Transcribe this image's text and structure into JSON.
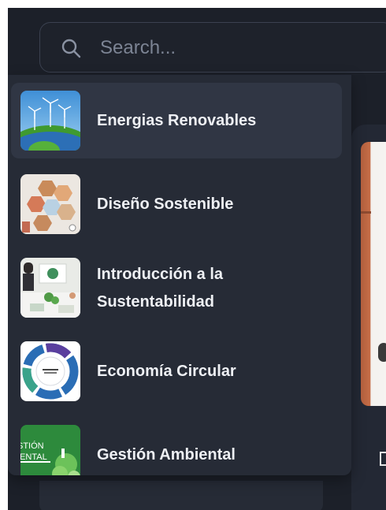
{
  "search": {
    "placeholder": "Search..."
  },
  "dropdown": {
    "items": [
      {
        "label": "Energias Renovables",
        "thumb": "wind-turbines-earth",
        "active": true
      },
      {
        "label": "Diseño Sostenible",
        "thumb": "hexagon-tiles"
      },
      {
        "label_line1": "Introducción a la",
        "label_line2": "Sustentabilidad",
        "thumb": "classroom-presentation"
      },
      {
        "label": "Economía Circular",
        "thumb": "circular-economy-diagram"
      },
      {
        "label": "Gestión Ambiental",
        "thumb_text": "STIÓN IENTAL",
        "thumb_line1": "STIÓN",
        "thumb_line2": "IENTAL"
      }
    ]
  },
  "colors": {
    "background": "#1c2029",
    "dropdown": "#262b36",
    "active_item": "#303644",
    "text": "#eef0f4"
  }
}
